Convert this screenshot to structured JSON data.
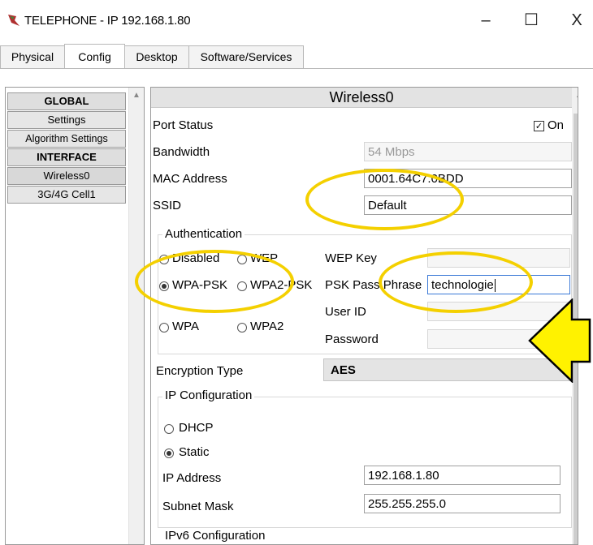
{
  "window": {
    "title": "TELEPHONE - IP 192.168.1.80",
    "minimize": "–",
    "maximize": "☐",
    "close": "X"
  },
  "tabs": [
    {
      "label": "Physical"
    },
    {
      "label": "Config"
    },
    {
      "label": "Desktop"
    },
    {
      "label": "Software/Services"
    }
  ],
  "nav": {
    "global": "GLOBAL",
    "settings": "Settings",
    "algorithm": "Algorithm Settings",
    "interface": "INTERFACE",
    "wireless0": "Wireless0",
    "cell": "3G/4G Cell1"
  },
  "panel": {
    "title": "Wireless0",
    "port_status": {
      "label": "Port Status",
      "on_label": "On",
      "checked": true
    },
    "bandwidth": {
      "label": "Bandwidth",
      "value": "54 Mbps"
    },
    "mac": {
      "label": "MAC Address",
      "value": "0001.64C7.0BDD"
    },
    "ssid": {
      "label": "SSID",
      "value": "Default"
    },
    "auth": {
      "title": "Authentication",
      "disabled": "Disabled",
      "wep": "WEP",
      "wpa_psk": "WPA-PSK",
      "wpa2_psk": "WPA2-PSK",
      "wpa": "WPA",
      "wpa2": "WPA2",
      "selected": "WPA-PSK",
      "wep_key_label": "WEP Key",
      "psk_label": "PSK Pass Phrase",
      "psk_value": "technologie",
      "user_id_label": "User ID",
      "password_label": "Password"
    },
    "encryption": {
      "label": "Encryption Type",
      "value": "AES"
    },
    "ip": {
      "title": "IP Configuration",
      "dhcp": "DHCP",
      "static": "Static",
      "selected": "Static",
      "address_label": "IP Address",
      "address_value": "192.168.1.80",
      "mask_label": "Subnet Mask",
      "mask_value": "255.255.255.0"
    },
    "ipv6_title": "IPv6 Configuration"
  },
  "colors": {
    "highlight": "#f4d000",
    "arrow_fill": "#fff200"
  }
}
